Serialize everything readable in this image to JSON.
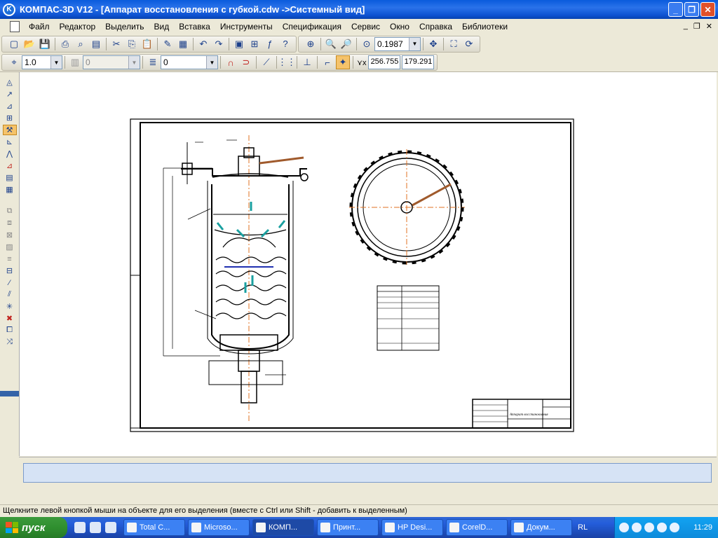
{
  "window": {
    "title": "КОМПАС-3D V12 - [Аппарат восстановления с губкой.cdw ->Системный вид]"
  },
  "menu": {
    "items": [
      "Файл",
      "Редактор",
      "Выделить",
      "Вид",
      "Вставка",
      "Инструменты",
      "Спецификация",
      "Сервис",
      "Окно",
      "Справка",
      "Библиотеки"
    ]
  },
  "toolbar": {
    "zoom_value": "0.1987",
    "step_value": "1.0",
    "layer_value": "0",
    "style_value": "0",
    "coord_x": "256.755",
    "coord_y": "179.291"
  },
  "statusbar": {
    "text": "Щелкните левой кнопкой мыши на объекте для его выделения (вместе с Ctrl или Shift - добавить к выделенным)"
  },
  "taskbar": {
    "start_label": "пуск",
    "tasks": [
      "Total C...",
      "Microso...",
      "КОМП...",
      "Принт...",
      "HP Desi...",
      "CorelD...",
      "Докум..."
    ],
    "lang": "RL",
    "clock": "11:29"
  },
  "drawing": {
    "stamp_name": "Аппарат восстановления"
  }
}
